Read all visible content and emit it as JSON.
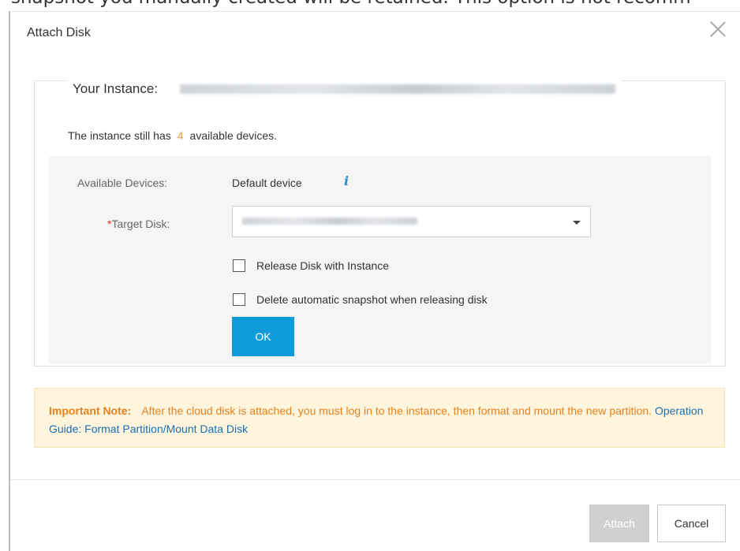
{
  "background": {
    "text": "snapshot you manually created will be retained. This option is not recomm"
  },
  "dialog": {
    "title": "Attach Disk",
    "close_icon": "close-icon"
  },
  "instance": {
    "label": "Your Instance:",
    "available_prefix": "The instance still has",
    "available_count": "4",
    "available_suffix": "available devices."
  },
  "form": {
    "available_devices_label": "Available Devices:",
    "available_devices_value": "Default device",
    "info_icon": "info-icon",
    "target_disk_required": "*",
    "target_disk_label": "Target Disk:",
    "release_disk_label": "Release Disk with Instance",
    "delete_snapshot_label": "Delete automatic snapshot when releasing disk",
    "ok_label": "OK"
  },
  "note": {
    "heading": "Important Note:",
    "text": "After the cloud disk is attached, you must log in to the instance, then format and mount the new partition.",
    "link": "Operation Guide: Format Partition/Mount Data Disk"
  },
  "footer": {
    "attach_label": "Attach",
    "cancel_label": "Cancel"
  },
  "colors": {
    "accent": "#0d9bd9",
    "warning_text": "#e8801c",
    "note_bg": "#fff5dc",
    "required": "#e0301e",
    "count": "#f39b3d",
    "link": "#1a6fb5"
  }
}
